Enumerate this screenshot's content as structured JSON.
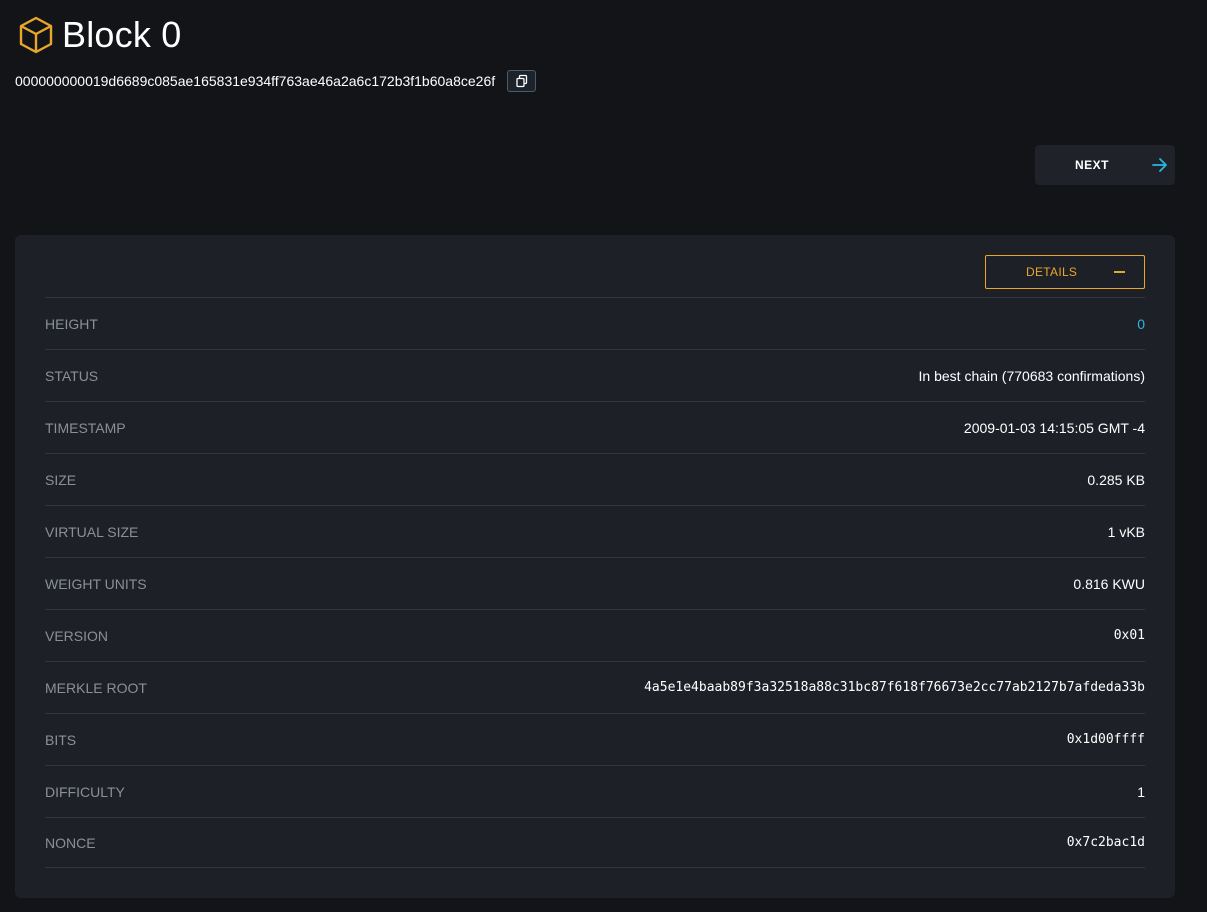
{
  "header": {
    "title": "Block 0",
    "block_hash": "000000000019d6689c085ae165831e934ff763ae46a2a6c172b3f1b60a8ce26f"
  },
  "nav": {
    "next_label": "NEXT"
  },
  "card": {
    "details_label": "DETAILS",
    "rows": [
      {
        "label": "HEIGHT",
        "value": "0"
      },
      {
        "label": "STATUS",
        "value": "In best chain (770683 confirmations)"
      },
      {
        "label": "TIMESTAMP",
        "value": "2009-01-03 14:15:05 GMT -4"
      },
      {
        "label": "SIZE",
        "value": "0.285 KB"
      },
      {
        "label": "VIRTUAL SIZE",
        "value": "1 vKB"
      },
      {
        "label": "WEIGHT UNITS",
        "value": "0.816 KWU"
      },
      {
        "label": "VERSION",
        "value": "0x01"
      },
      {
        "label": "MERKLE ROOT",
        "value": "4a5e1e4baab89f3a32518a88c31bc87f618f76673e2cc77ab2127b7afdeda33b"
      },
      {
        "label": "BITS",
        "value": "0x1d00ffff"
      },
      {
        "label": "DIFFICULTY",
        "value": "1"
      },
      {
        "label": "NONCE",
        "value": "0x7c2bac1d"
      }
    ]
  },
  "colors": {
    "accent": "#e8a72b",
    "link": "#29b6e6",
    "background": "#131418",
    "card": "#1e2028"
  },
  "icons": {
    "title_icon": "cube-icon",
    "copy_icon": "copy-icon",
    "next_icon": "arrow-right-icon",
    "details_icon": "minus-icon"
  }
}
